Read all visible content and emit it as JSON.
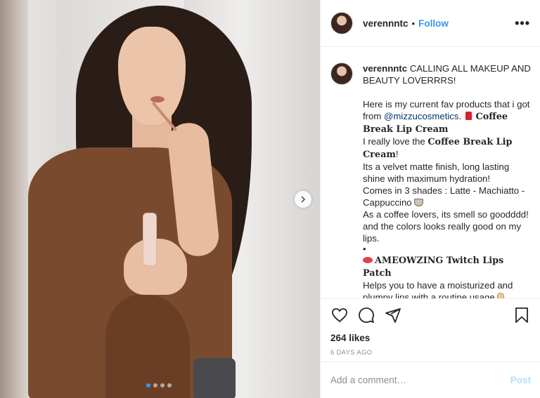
{
  "post": {
    "username": "verennntc",
    "separator": "•",
    "follow_label": "Follow",
    "more_label": "•••"
  },
  "carousel": {
    "total_slides": 4,
    "active_index": 0
  },
  "caption": {
    "username": "verennntc",
    "headline": "CALLING ALL MAKEUP AND BEAUTY LOVERRRS!",
    "p1_before": "Here is my current fav products that i got from ",
    "p1_mention": "@mizzucosmetics.",
    "p1_product": "Coffee Break Lip Cream",
    "p2_before": "I really love the ",
    "p2_product": "Coffee Break Lip Cream",
    "p2_after": "!",
    "p3": "Its a velvet matte finish, long lasting shine with maximum hydration!",
    "p4": "Comes in 3 shades : Latte - Machiatto - Cappuccino",
    "p5": "As a coffee lovers, its smell so goodddd! and the colors looks really good on my lips.",
    "bullet": "•",
    "p6_product": "AMEOWZING Twitch Lips Patch",
    "p7": "Helps you to have a moisturized and plumpy lips with a routine usage",
    "bullet2": "•"
  },
  "actions": {
    "likes": "264 likes",
    "time_ago": "6 DAYS AGO"
  },
  "comment": {
    "placeholder": "Add a comment…",
    "post_label": "Post"
  },
  "colors": {
    "follow_blue": "#3897f0",
    "post_disabled": "#b2dffc",
    "muted_text": "#8e8e8e"
  },
  "icons": [
    "heart-icon",
    "comment-icon",
    "share-icon",
    "bookmark-icon",
    "chevron-right-icon",
    "more-icon"
  ]
}
